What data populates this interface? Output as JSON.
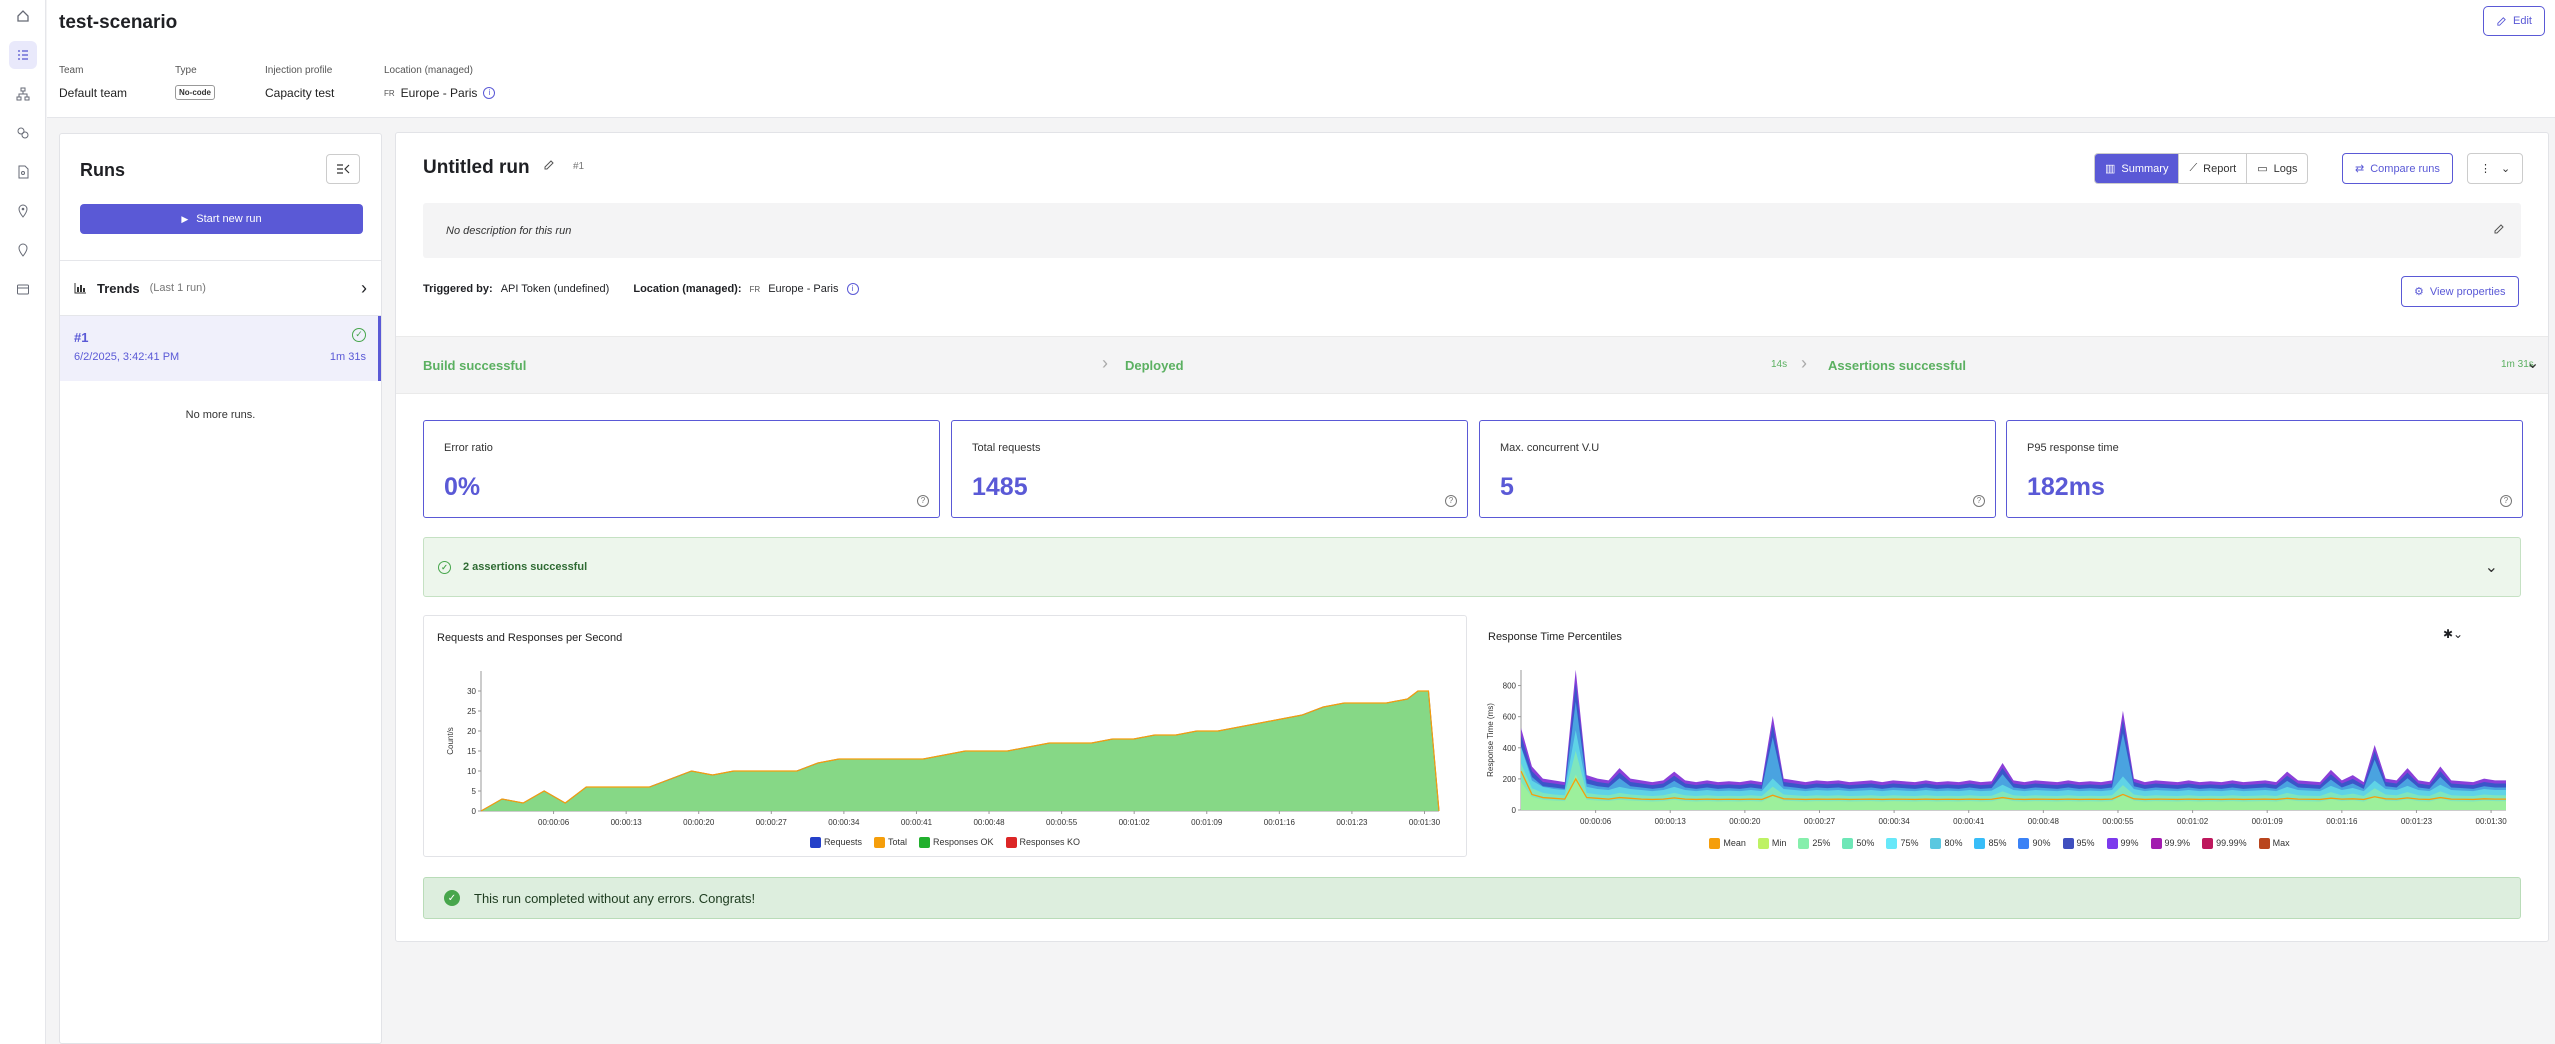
{
  "scenario": {
    "title": "test-scenario",
    "edit_label": "Edit"
  },
  "meta": {
    "team_label": "Team",
    "team_value": "Default team",
    "type_label": "Type",
    "type_value": "No-code",
    "injection_label": "Injection profile",
    "injection_value": "Capacity test",
    "location_label": "Location (managed)",
    "location_flag": "FR",
    "location_value": "Europe - Paris"
  },
  "runs_panel": {
    "title": "Runs",
    "start_label": "Start new run",
    "trends_label": "Trends",
    "trends_sub": "(Last 1 run)",
    "run": {
      "id": "#1",
      "date": "6/2/2025, 3:42:41 PM",
      "duration": "1m 31s"
    },
    "no_more": "No more runs."
  },
  "run": {
    "title": "Untitled run",
    "number": "#1",
    "tabs": [
      "Summary",
      "Report",
      "Logs"
    ],
    "compare_label": "Compare runs",
    "description": "No description for this run",
    "triggered_label": "Triggered by:",
    "triggered_value": "API Token (undefined)",
    "location_label": "Location (managed):",
    "location_flag": "FR",
    "location_value": "Europe - Paris",
    "view_props_label": "View properties"
  },
  "pipeline": {
    "build": "Build successful",
    "deployed": "Deployed",
    "deployed_time": "14s",
    "assertions": "Assertions successful",
    "assertions_time": "1m 31s"
  },
  "cards": [
    {
      "label": "Error ratio",
      "value": "0%"
    },
    {
      "label": "Total requests",
      "value": "1485"
    },
    {
      "label": "Max. concurrent V.U",
      "value": "5"
    },
    {
      "label": "P95 response time",
      "value": "182ms"
    }
  ],
  "assertions_bar": "2 assertions successful",
  "congrats": "This run completed without any errors. Congrats!",
  "colors": {
    "accent": "#5a59d6",
    "success": "#5bb061"
  },
  "chart_data": [
    {
      "type": "area",
      "title": "Requests and Responses per Second",
      "ylabel": "Count/s",
      "ylim": [
        0,
        35
      ],
      "yticks": [
        0,
        5,
        10,
        15,
        20,
        25,
        30
      ],
      "xticks": [
        "00:00:06",
        "00:00:13",
        "00:00:20",
        "00:00:27",
        "00:00:34",
        "00:00:41",
        "00:00:48",
        "00:00:55",
        "00:01:02",
        "00:01:09",
        "00:01:16",
        "00:01:23",
        "00:01:30"
      ],
      "x": [
        0,
        2,
        4,
        6,
        8,
        10,
        12,
        14,
        16,
        18,
        20,
        22,
        24,
        26,
        28,
        30,
        32,
        34,
        36,
        38,
        40,
        42,
        44,
        46,
        48,
        50,
        52,
        54,
        56,
        58,
        60,
        62,
        64,
        66,
        68,
        70,
        72,
        74,
        76,
        78,
        80,
        82,
        84,
        86,
        88,
        89,
        90,
        91
      ],
      "series": [
        {
          "name": "Requests",
          "color": "#2440c9",
          "values": [
            0,
            3,
            2,
            5,
            2,
            6,
            6,
            6,
            6,
            8,
            10,
            9,
            10,
            10,
            10,
            10,
            12,
            13,
            13,
            13,
            13,
            13,
            14,
            15,
            15,
            15,
            16,
            17,
            17,
            17,
            18,
            18,
            19,
            19,
            20,
            20,
            21,
            22,
            23,
            24,
            26,
            27,
            27,
            27,
            28,
            30,
            30,
            0
          ]
        },
        {
          "name": "Total",
          "color": "#f59e0b",
          "values": [
            0,
            3,
            2,
            5,
            2,
            6,
            6,
            6,
            6,
            8,
            10,
            9,
            10,
            10,
            10,
            10,
            12,
            13,
            13,
            13,
            13,
            13,
            14,
            15,
            15,
            15,
            16,
            17,
            17,
            17,
            18,
            18,
            19,
            19,
            20,
            20,
            21,
            22,
            23,
            24,
            26,
            27,
            27,
            27,
            28,
            30,
            30,
            0
          ]
        },
        {
          "name": "Responses OK",
          "color": "#22b02e",
          "values": [
            0,
            3,
            2,
            5,
            2,
            6,
            6,
            6,
            6,
            8,
            10,
            9,
            10,
            10,
            10,
            10,
            12,
            13,
            13,
            13,
            13,
            13,
            14,
            15,
            15,
            15,
            16,
            17,
            17,
            17,
            18,
            18,
            19,
            19,
            20,
            20,
            21,
            22,
            23,
            24,
            26,
            27,
            27,
            27,
            28,
            30,
            30,
            0
          ]
        },
        {
          "name": "Responses KO",
          "color": "#dc2626",
          "values": [
            0,
            0,
            0,
            0,
            0,
            0,
            0,
            0,
            0,
            0,
            0,
            0,
            0,
            0,
            0,
            0,
            0,
            0,
            0,
            0,
            0,
            0,
            0,
            0,
            0,
            0,
            0,
            0,
            0,
            0,
            0,
            0,
            0,
            0,
            0,
            0,
            0,
            0,
            0,
            0,
            0,
            0,
            0,
            0,
            0,
            0,
            0,
            0
          ]
        }
      ]
    },
    {
      "type": "area",
      "title": "Response Time Percentiles",
      "ylabel": "Response Time (ms)",
      "ylim": [
        0,
        900
      ],
      "yticks": [
        0,
        200,
        400,
        600,
        800
      ],
      "xticks": [
        "00:00:06",
        "00:00:13",
        "00:00:20",
        "00:00:27",
        "00:00:34",
        "00:00:41",
        "00:00:48",
        "00:00:55",
        "00:01:02",
        "00:01:09",
        "00:01:16",
        "00:01:23",
        "00:01:30"
      ],
      "legend": [
        "Mean",
        "Min",
        "25%",
        "50%",
        "75%",
        "80%",
        "85%",
        "90%",
        "95%",
        "99%",
        "99.9%",
        "99.99%",
        "Max"
      ],
      "legend_colors": [
        "#f59e0b",
        "#bef264",
        "#86efac",
        "#6ee7b7",
        "#67e8f9",
        "#5ac8e0",
        "#38bdf8",
        "#3b82f6",
        "#3f4fbf",
        "#7c3aed",
        "#a21caf",
        "#be185d",
        "#b9451d"
      ],
      "x": [
        1,
        2,
        3,
        4,
        5,
        6,
        7,
        8,
        9,
        10,
        11,
        12,
        13,
        14,
        15,
        16,
        17,
        18,
        19,
        20,
        21,
        22,
        23,
        24,
        25,
        26,
        27,
        28,
        29,
        30,
        31,
        32,
        33,
        34,
        35,
        36,
        37,
        38,
        39,
        40,
        41,
        42,
        43,
        44,
        45,
        46,
        47,
        48,
        49,
        50,
        51,
        52,
        53,
        54,
        55,
        56,
        57,
        58,
        59,
        60,
        61,
        62,
        63,
        64,
        65,
        66,
        67,
        68,
        69,
        70,
        71,
        72,
        73,
        74,
        75,
        76,
        77,
        78,
        79,
        80,
        81,
        82,
        83,
        84,
        85,
        86,
        87,
        88,
        89,
        90,
        91
      ],
      "p95": [
        480,
        250,
        180,
        170,
        160,
        820,
        200,
        180,
        170,
        240,
        180,
        170,
        160,
        170,
        220,
        170,
        160,
        170,
        160,
        165,
        160,
        170,
        160,
        550,
        180,
        170,
        160,
        170,
        165,
        170,
        160,
        165,
        170,
        160,
        170,
        165,
        160,
        170,
        160,
        165,
        160,
        170,
        160,
        165,
        270,
        170,
        160,
        170,
        165,
        160,
        170,
        160,
        165,
        160,
        170,
        580,
        180,
        160,
        170,
        165,
        160,
        170,
        160,
        165,
        160,
        170,
        160,
        165,
        170,
        160,
        220,
        170,
        165,
        160,
        230,
        170,
        200,
        160,
        380,
        180,
        170,
        240,
        170,
        160,
        250,
        170,
        165,
        160,
        180,
        170,
        170
      ],
      "p50": [
        300,
        140,
        110,
        100,
        95,
        380,
        110,
        100,
        95,
        110,
        100,
        95,
        90,
        95,
        110,
        95,
        90,
        95,
        90,
        92,
        90,
        95,
        90,
        150,
        100,
        95,
        90,
        95,
        92,
        95,
        90,
        92,
        95,
        90,
        95,
        92,
        90,
        95,
        90,
        92,
        90,
        95,
        90,
        92,
        120,
        95,
        90,
        95,
        92,
        90,
        95,
        90,
        92,
        90,
        95,
        160,
        100,
        90,
        95,
        92,
        90,
        95,
        90,
        92,
        90,
        95,
        90,
        92,
        95,
        90,
        110,
        95,
        92,
        90,
        115,
        95,
        105,
        90,
        140,
        100,
        95,
        115,
        95,
        90,
        120,
        95,
        92,
        90,
        100,
        95,
        95
      ],
      "mean": [
        250,
        100,
        80,
        75,
        70,
        200,
        80,
        75,
        70,
        80,
        75,
        70,
        68,
        70,
        78,
        70,
        68,
        70,
        68,
        69,
        68,
        70,
        68,
        95,
        72,
        70,
        68,
        70,
        69,
        70,
        68,
        69,
        70,
        68,
        70,
        69,
        68,
        70,
        68,
        69,
        68,
        70,
        68,
        69,
        80,
        70,
        68,
        70,
        69,
        68,
        70,
        68,
        69,
        68,
        70,
        100,
        72,
        68,
        70,
        69,
        68,
        70,
        68,
        69,
        68,
        70,
        68,
        69,
        70,
        68,
        75,
        70,
        69,
        68,
        76,
        70,
        72,
        68,
        85,
        72,
        70,
        78,
        70,
        68,
        80,
        70,
        69,
        68,
        72,
        70,
        70
      ]
    }
  ]
}
